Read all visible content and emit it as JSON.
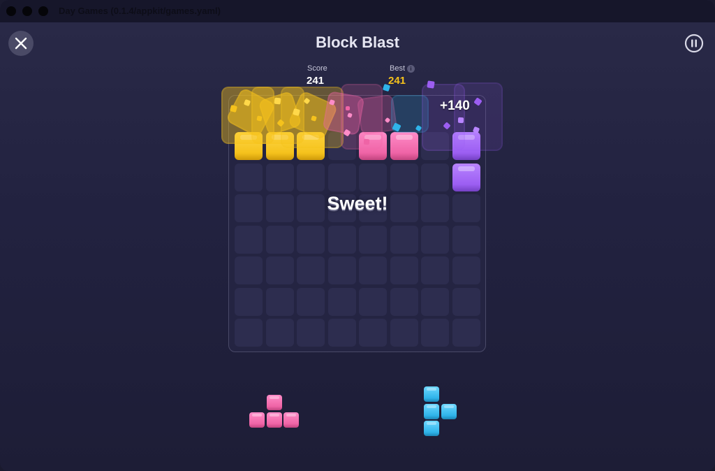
{
  "window": {
    "title": "Day Games (0.1.4/appkit/games.yaml)"
  },
  "header": {
    "title": "Block Blast",
    "close_icon": "close-x-icon",
    "pause_icon": "pause-icon"
  },
  "stats": {
    "score_label": "Score",
    "score_value": "241",
    "best_label": "Best",
    "best_value": "241",
    "best_info_icon": "info-icon"
  },
  "board": {
    "rows": 7,
    "cols": 8,
    "filled_cells": [
      {
        "row": 0,
        "col": 0,
        "color": "yellow"
      },
      {
        "row": 0,
        "col": 1,
        "color": "yellow"
      },
      {
        "row": 0,
        "col": 2,
        "color": "yellow"
      },
      {
        "row": 0,
        "col": 4,
        "color": "pink"
      },
      {
        "row": 0,
        "col": 5,
        "color": "pink"
      },
      {
        "row": 0,
        "col": 7,
        "color": "purple"
      },
      {
        "row": 1,
        "col": 7,
        "color": "purple"
      }
    ]
  },
  "feedback": {
    "message": "Sweet!",
    "points": "+140"
  },
  "tray": {
    "pieces": [
      {
        "name": "pink-t-piece",
        "color": "pink",
        "cells": [
          [
            0,
            1
          ],
          [
            1,
            0
          ],
          [
            1,
            1
          ],
          [
            1,
            2
          ]
        ]
      },
      {
        "name": "cyan-t-piece",
        "color": "cyan",
        "cells": [
          [
            0,
            0
          ],
          [
            1,
            0
          ],
          [
            1,
            1
          ],
          [
            2,
            0
          ]
        ]
      }
    ]
  },
  "colors": {
    "yellow": "#f5c21c",
    "pink": "#ef64a6",
    "purple": "#9c5ef2",
    "cyan": "#2fb4ea",
    "best_value": "#f5c21c",
    "score_value": "#ffffff"
  }
}
